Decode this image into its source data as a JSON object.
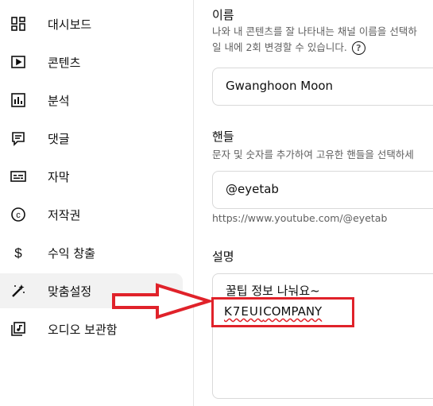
{
  "sidebar": {
    "items": [
      {
        "label": "대시보드",
        "icon": "dashboard-icon"
      },
      {
        "label": "콘텐츠",
        "icon": "content-icon"
      },
      {
        "label": "분석",
        "icon": "analytics-icon"
      },
      {
        "label": "댓글",
        "icon": "comments-icon"
      },
      {
        "label": "자막",
        "icon": "subtitles-icon"
      },
      {
        "label": "저작권",
        "icon": "copyright-icon"
      },
      {
        "label": "수익 창출",
        "icon": "dollar-icon"
      },
      {
        "label": "맞춤설정",
        "icon": "magic-wand-icon",
        "active": true
      },
      {
        "label": "오디오 보관함",
        "icon": "audio-library-icon"
      }
    ]
  },
  "main": {
    "name_section": {
      "title": "이름",
      "desc_line1": "나와 내 콘텐츠를 잘 나타내는 채널 이름을 선택하",
      "desc_line2": "일 내에 2회 변경할 수 있습니다.",
      "help_glyph": "?",
      "value": "Gwanghoon Moon"
    },
    "handle_section": {
      "title": "핸들",
      "desc": "문자 및 숫자를 추가하여 고유한 핸들을 선택하세",
      "value": "@eyetab",
      "url": "https://www.youtube.com/@eyetab"
    },
    "description_section": {
      "title": "설명",
      "line1": "꿀팁 정보 나눠요~",
      "line2_logo": "K7EUI",
      "line2_rest": "COMPANY"
    }
  },
  "annotation": {
    "arrow_color": "#e0222a",
    "box_color": "#e0222a"
  }
}
